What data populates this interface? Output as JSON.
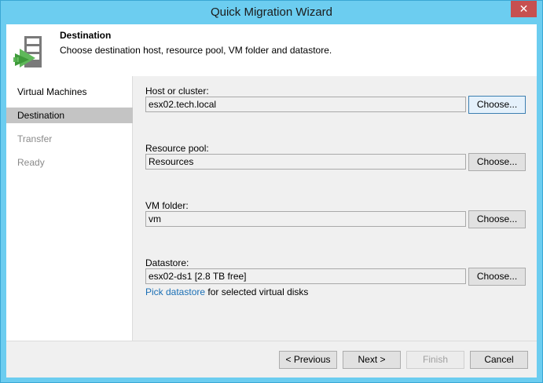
{
  "window": {
    "title": "Quick Migration Wizard",
    "close_label": "✕"
  },
  "header": {
    "title": "Destination",
    "description": "Choose destination host, resource pool, VM folder and datastore."
  },
  "nav": {
    "items": [
      {
        "label": "Virtual Machines",
        "state": "normal"
      },
      {
        "label": "Destination",
        "state": "selected"
      },
      {
        "label": "Transfer",
        "state": "disabled"
      },
      {
        "label": "Ready",
        "state": "disabled"
      }
    ]
  },
  "fields": {
    "host": {
      "label": "Host or cluster:",
      "value": "esx02.tech.local",
      "button": "Choose..."
    },
    "pool": {
      "label": "Resource pool:",
      "value": "Resources",
      "button": "Choose..."
    },
    "folder": {
      "label": "VM folder:",
      "value": "vm",
      "button": "Choose..."
    },
    "datastore": {
      "label": "Datastore:",
      "value": "esx02-ds1 [2.8 TB free]",
      "button": "Choose..."
    }
  },
  "pick": {
    "link": "Pick datastore",
    "text": " for selected virtual disks"
  },
  "footer": {
    "previous": "< Previous",
    "next": "Next >",
    "finish": "Finish",
    "cancel": "Cancel"
  },
  "colors": {
    "titlebar": "#6ccdf0",
    "close": "#c75050",
    "link": "#1a6fb5",
    "selected_nav": "#c4c4c4"
  }
}
